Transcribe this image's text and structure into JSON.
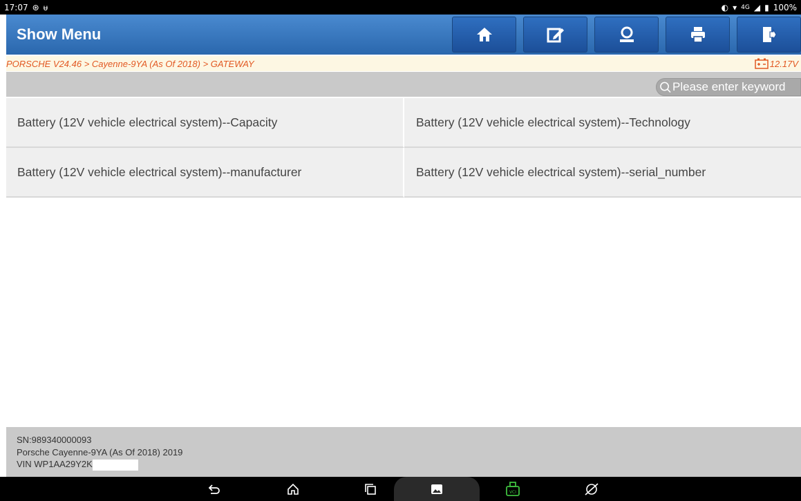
{
  "status": {
    "time": "17:07",
    "network": "4G",
    "battery": "100%"
  },
  "header": {
    "title": "Show Menu",
    "buttons": [
      {
        "name": "home-icon"
      },
      {
        "name": "edit-report-icon"
      },
      {
        "name": "remote-support-icon"
      },
      {
        "name": "print-icon"
      },
      {
        "name": "exit-icon"
      }
    ]
  },
  "breadcrumb": {
    "path": "PORSCHE V24.46 > Cayenne-9YA (As Of 2018) > GATEWAY",
    "voltage": "12.17V"
  },
  "search": {
    "placeholder": "Please enter keyword"
  },
  "items": [
    {
      "label": "Battery (12V vehicle electrical system)--Capacity"
    },
    {
      "label": "Battery (12V vehicle electrical system)--Technology"
    },
    {
      "label": "Battery (12V vehicle electrical system)--manufacturer"
    },
    {
      "label": "Battery (12V vehicle electrical system)--serial_number"
    }
  ],
  "footer": {
    "sn": "SN:989340000093",
    "vehicle": "Porsche Cayenne-9YA (As Of 2018) 2019",
    "vin": "VIN WP1AA29Y2K"
  },
  "colors": {
    "header": "#2a67ad",
    "accent": "#e25822",
    "vci": "#3fbf3f"
  }
}
